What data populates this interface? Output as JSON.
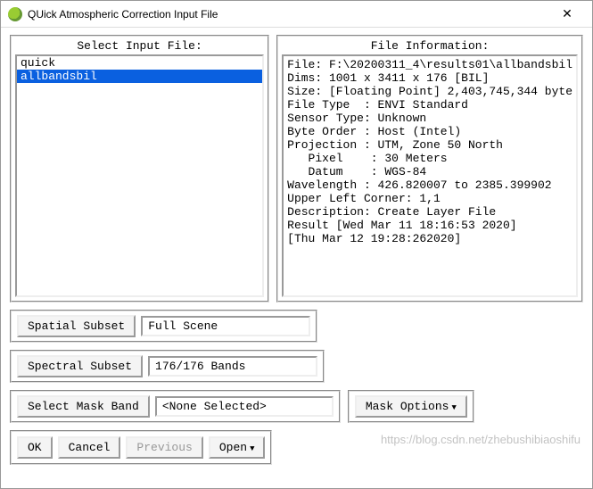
{
  "window": {
    "title": "QUick Atmospheric Correction Input File",
    "close_glyph": "✕"
  },
  "left_panel": {
    "title": "Select Input File:",
    "items": [
      "quick",
      "allbandsbil"
    ],
    "selected_index": 1
  },
  "right_panel": {
    "title": "File Information:",
    "lines": [
      "File: F:\\20200311_4\\results01\\allbandsbil",
      "Dims: 1001 x 3411 x 176 [BIL]",
      "Size: [Floating Point] 2,403,745,344 byte",
      "File Type  : ENVI Standard",
      "Sensor Type: Unknown",
      "Byte Order : Host (Intel)",
      "Projection : UTM, Zone 50 North",
      "   Pixel    : 30 Meters",
      "   Datum    : WGS-84",
      "Wavelength : 426.820007 to 2385.399902",
      "Upper Left Corner: 1,1",
      "Description: Create Layer File",
      "Result [Wed Mar 11 18:16:53 2020]",
      "[Thu Mar 12 19:28:262020]"
    ]
  },
  "spatial": {
    "button": "Spatial Subset",
    "value": "Full Scene"
  },
  "spectral": {
    "button": "Spectral Subset",
    "value": "176/176 Bands"
  },
  "mask": {
    "select_button": "Select Mask Band",
    "value": "<None Selected>",
    "options_button": "Mask Options",
    "arrow": "▼"
  },
  "buttons": {
    "ok": "OK",
    "cancel": "Cancel",
    "previous": "Previous",
    "open": "Open",
    "open_arrow": "▼"
  },
  "watermark": "https://blog.csdn.net/zhebushibiaoshifu"
}
